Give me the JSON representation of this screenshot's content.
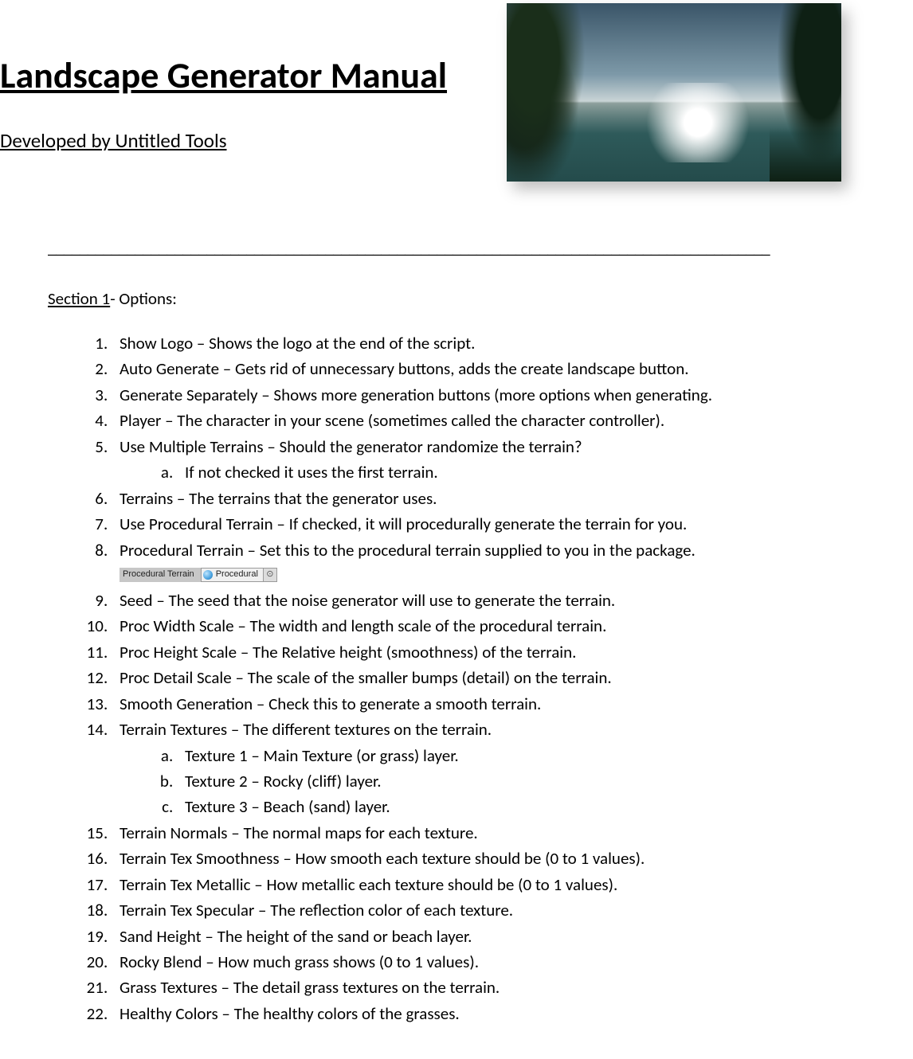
{
  "header": {
    "title": "Landscape Generator Manual",
    "subtitle": "Developed by Untitled Tools"
  },
  "divider": "___________________________________________________________________________________________",
  "section": {
    "label": "Section 1",
    "suffix": "- Options:"
  },
  "options": [
    {
      "text": "Show Logo – Shows the logo at the end of the script."
    },
    {
      "text": "Auto Generate – Gets rid of unnecessary buttons, adds the create landscape button."
    },
    {
      "text": "Generate Separately – Shows more generation buttons (more options when generating."
    },
    {
      "text": "Player – The character in your scene (sometimes called the character controller)."
    },
    {
      "text": "Use Multiple Terrains – Should the generator randomize the terrain?",
      "sub": [
        "If not checked it uses the first terrain."
      ]
    },
    {
      "text": "Terrains – The terrains that the generator uses."
    },
    {
      "text": "Use Procedural Terrain – If checked, it will procedurally generate the terrain for you."
    },
    {
      "text": "Procedural Terrain – Set this to the procedural terrain supplied to you in the package.",
      "field": {
        "label": "Procedural Terrain",
        "value": "Procedural"
      }
    },
    {
      "text": "Seed – The seed that the noise generator will use to generate the terrain."
    },
    {
      "text": "Proc Width Scale – The width and length scale of the procedural terrain."
    },
    {
      "text": "Proc Height Scale – The Relative height (smoothness) of the terrain."
    },
    {
      "text": "Proc Detail Scale – The scale of the smaller bumps (detail) on the terrain."
    },
    {
      "text": "Smooth Generation – Check this to generate a smooth terrain."
    },
    {
      "text": "Terrain Textures – The different textures on the terrain.",
      "sub": [
        "Texture 1 – Main Texture (or grass) layer.",
        "Texture 2 – Rocky (cliff) layer.",
        "Texture 3 – Beach (sand) layer."
      ]
    },
    {
      "text": "Terrain Normals – The normal maps for each texture."
    },
    {
      "text": "Terrain Tex Smoothness – How smooth each texture should be (0 to 1 values)."
    },
    {
      "text": "Terrain Tex Metallic – How metallic each texture should be (0 to 1 values)."
    },
    {
      "text": "Terrain Tex Specular – The reflection color of each texture."
    },
    {
      "text": "Sand Height – The height of the sand or beach layer."
    },
    {
      "text": "Rocky Blend – How much grass shows (0 to 1 values)."
    },
    {
      "text": "Grass Textures – The detail grass textures on the terrain."
    },
    {
      "text": "Healthy Colors – The healthy colors of the grasses."
    }
  ]
}
